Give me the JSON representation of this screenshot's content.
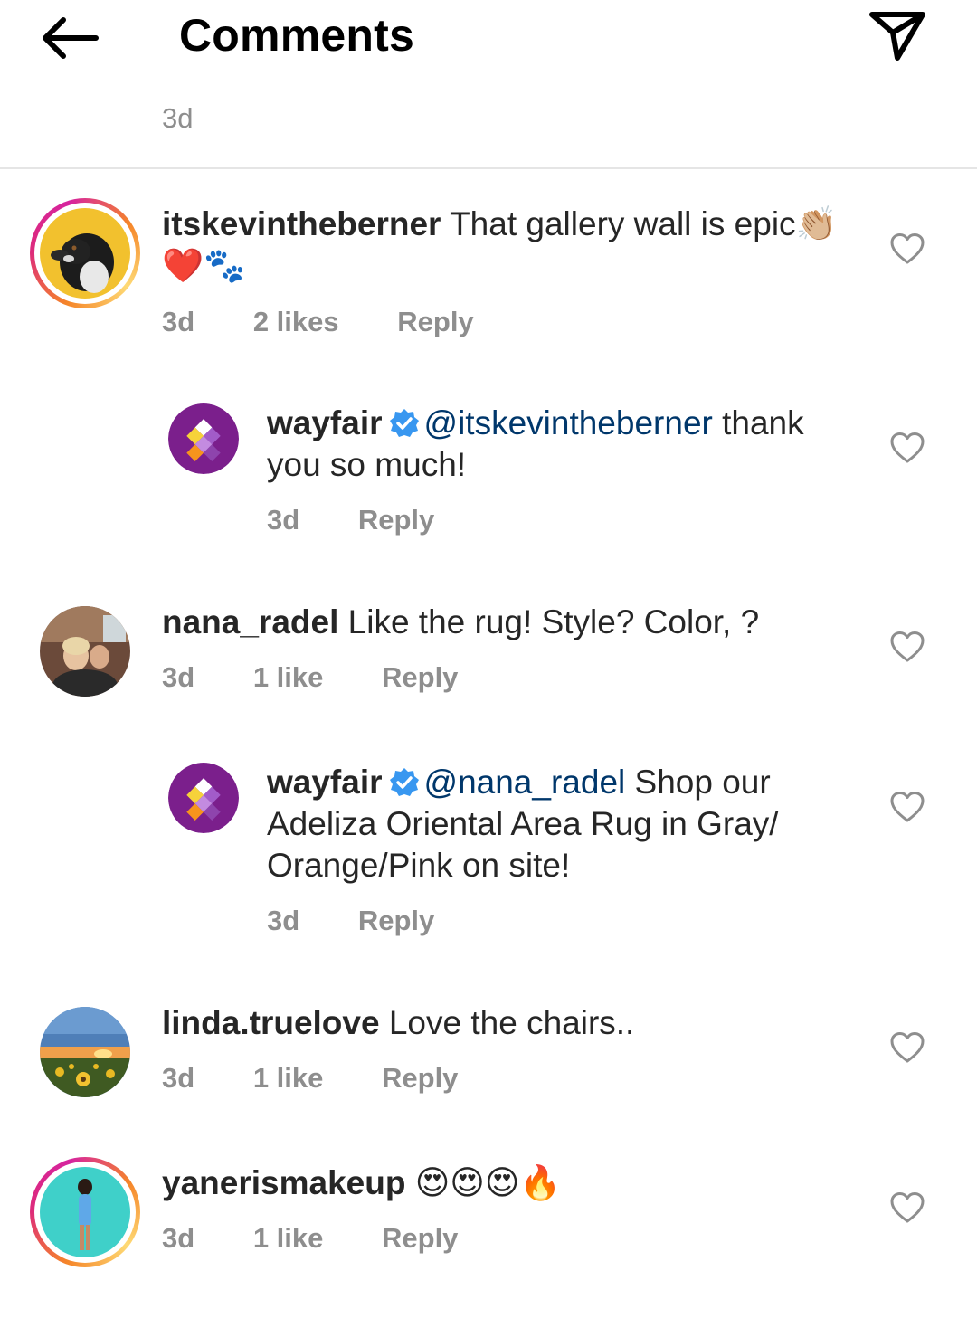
{
  "header": {
    "title": "Comments",
    "back_icon": "arrow-left-icon",
    "send_icon": "paper-plane-icon"
  },
  "caption": {
    "time": "3d"
  },
  "colors": {
    "text": "#262626",
    "secondary": "#8e8e8e",
    "mention": "#00376b",
    "verified": "#3897f0",
    "wayfair_purple": "#7b1f8c"
  },
  "comments": [
    {
      "username": "itskevintheberner",
      "text": "That gallery wall is epic",
      "emoji": "👏🏼❤️🐾",
      "time": "3d",
      "likes": "2 likes",
      "reply": "Reply"
    },
    {
      "username": "wayfair",
      "verified": true,
      "mention": "@itskevintheberner",
      "text": "thank you so much!",
      "time": "3d",
      "reply": "Reply"
    },
    {
      "username": "nana_radel",
      "text": "Like the rug! Style? Color, ?",
      "time": "3d",
      "likes": "1 like",
      "reply": "Reply"
    },
    {
      "username": "wayfair",
      "verified": true,
      "mention": "@nana_radel",
      "text": "Shop our Adeliza Oriental Area Rug in Gray/ Orange/Pink on site!",
      "time": "3d",
      "reply": "Reply"
    },
    {
      "username": "linda.truelove",
      "text": "Love the chairs..",
      "time": "3d",
      "likes": "1 like",
      "reply": "Reply"
    },
    {
      "username": "yanerismakeup",
      "emoji": "😍😍😍🔥",
      "time": "3d",
      "likes": "1 like",
      "reply": "Reply"
    }
  ]
}
